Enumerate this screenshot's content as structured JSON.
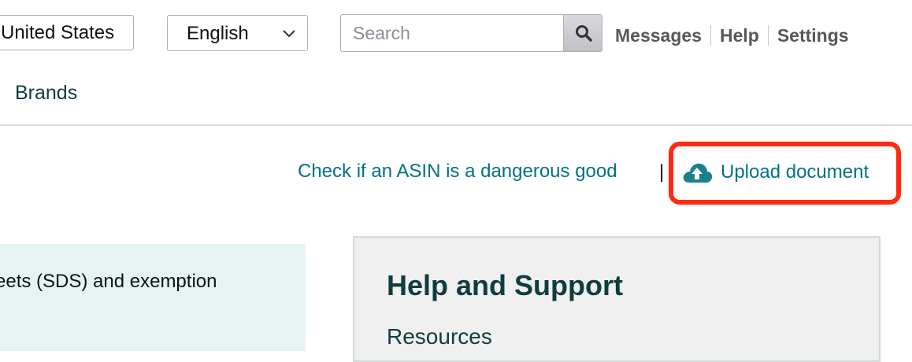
{
  "header": {
    "country": "United States",
    "language": {
      "selected": "English"
    },
    "search": {
      "placeholder": "Search"
    },
    "links": [
      "Messages",
      "Help",
      "Settings"
    ]
  },
  "nav": {
    "brands": "Brands"
  },
  "actions": {
    "check_asin": "Check if an ASIN is a dangerous good",
    "separator": "|",
    "upload": "Upload document"
  },
  "info_panel": {
    "text": "eets (SDS) and exemption"
  },
  "help_panel": {
    "title": "Help and Support",
    "subtitle": "Resources"
  },
  "colors": {
    "link": "#007185",
    "highlight": "#ff2a12",
    "panel_teal": "#e6f3f3",
    "heading": "#0f3d3e"
  },
  "icons": {
    "search": "magnifier-icon",
    "upload": "cloud-upload-icon",
    "dropdown": "chevron-down-icon"
  }
}
